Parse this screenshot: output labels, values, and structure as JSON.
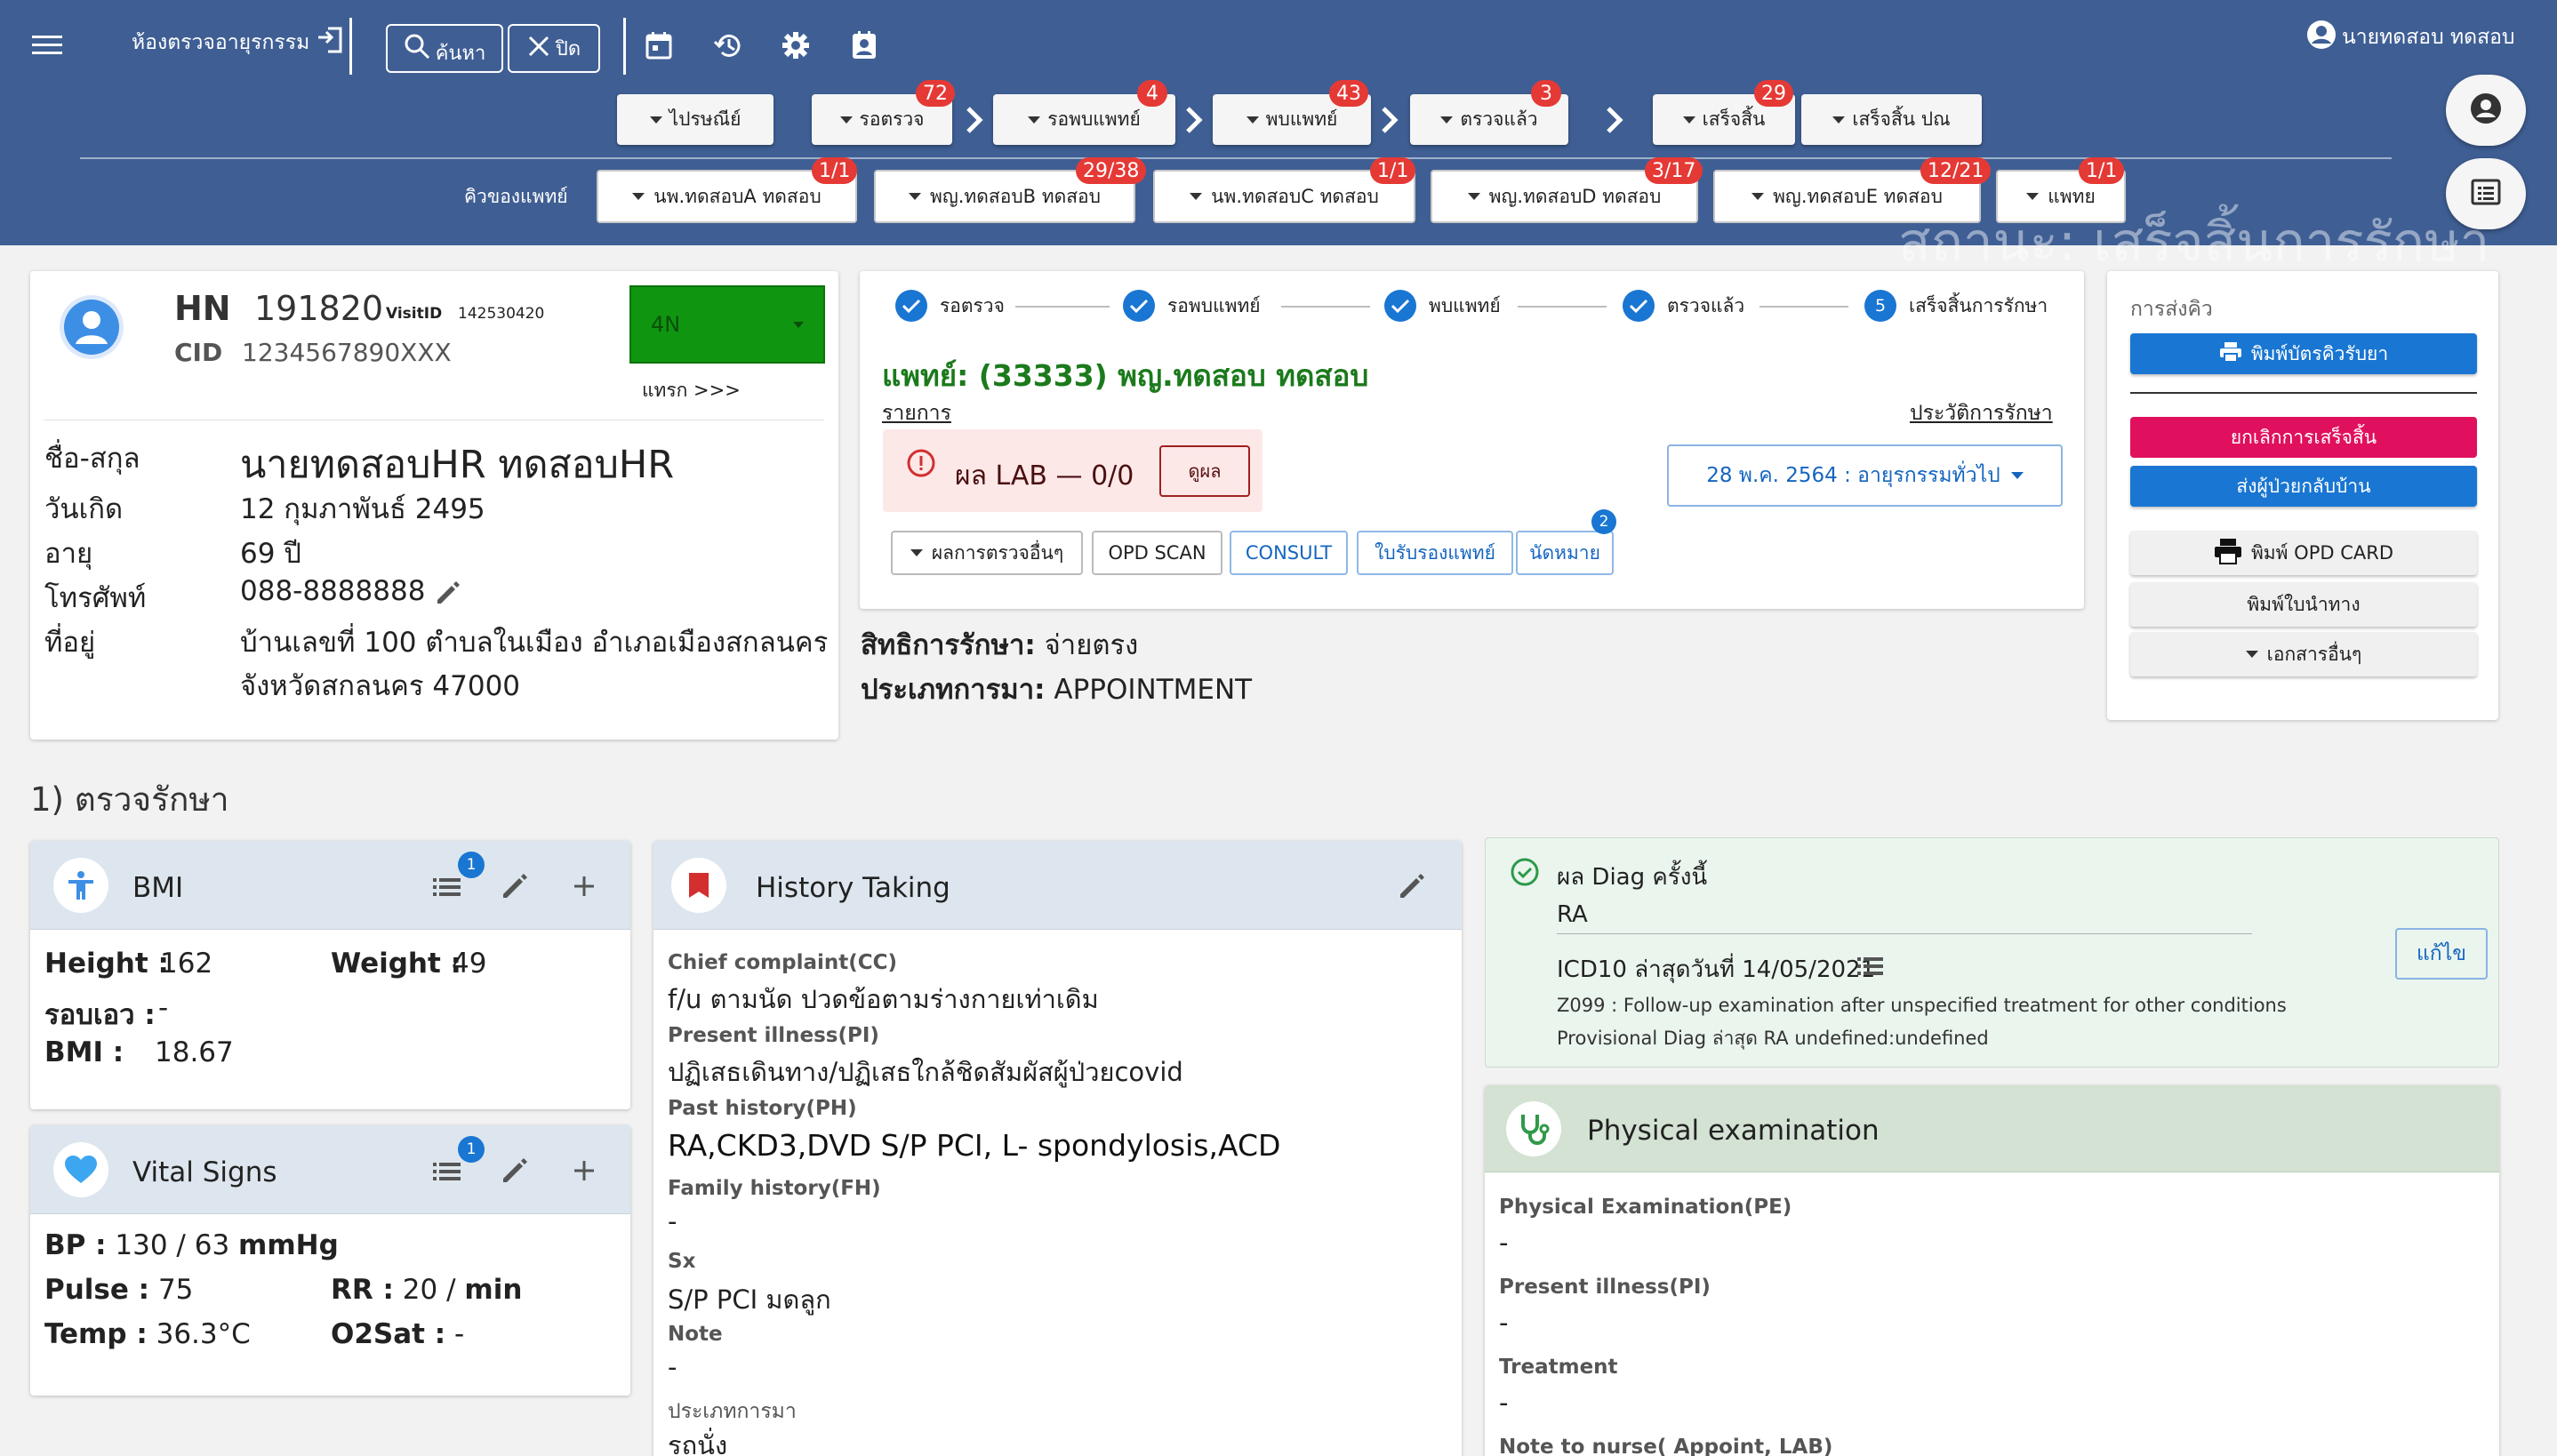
{
  "header": {
    "room_label": "ห้องตรวจอายุรกรรม",
    "search_label": "ค้นหา",
    "close_label": "ปิด",
    "user_name": "นายทดสอบ ทดสอบ",
    "ghost_status": "สถานะ: เสร็จสิ้นการรักษา"
  },
  "status_buttons": [
    {
      "label": "ไปรษณีย์",
      "badge": ""
    },
    {
      "label": "รอตรวจ",
      "badge": "72"
    },
    {
      "label": "รอพบแพทย์",
      "badge": "4"
    },
    {
      "label": "พบแพทย์",
      "badge": "43"
    },
    {
      "label": "ตรวจแล้ว",
      "badge": "3"
    },
    {
      "label": "เสร็จสิ้น",
      "badge": "29"
    },
    {
      "label": "เสร็จสิ้น ปณ",
      "badge": ""
    }
  ],
  "doctor_queue": {
    "label": "คิวของแพทย์",
    "doctors": [
      {
        "label": "นพ.ทดสอบA ทดสอบ",
        "badge": "1/1"
      },
      {
        "label": "พญ.ทดสอบB ทดสอบ",
        "badge": "29/38"
      },
      {
        "label": "นพ.ทดสอบC ทดสอบ",
        "badge": "1/1"
      },
      {
        "label": "พญ.ทดสอบD ทดสอบ",
        "badge": "3/17"
      },
      {
        "label": "พญ.ทดสอบE ทดสอบ",
        "badge": "12/21"
      },
      {
        "label": "แพทย",
        "badge": "1/1"
      }
    ]
  },
  "patient": {
    "hn_label": "HN",
    "hn": "191820",
    "visit_label": "VisitID",
    "visit_id": "142530420",
    "cid_label": "CID",
    "cid": "1234567890XXX",
    "zone": "4N",
    "insert_link": "แทรก >>>",
    "name_label": "ชื่อ-สกุล",
    "name": "นายทดสอบHR ทดสอบHR",
    "dob_label": "วันเกิด",
    "dob": "12 กุมภาพันธ์ 2495",
    "age_label": "อายุ",
    "age": "69 ปี",
    "phone_label": "โทรศัพท์",
    "phone": "088-8888888",
    "address_label": "ที่อยู่",
    "address_line1": "บ้านเลขที่ 100 ตำบลในเมือง อำเภอเมืองสกลนคร",
    "address_line2": "จังหวัดสกลนคร 47000"
  },
  "workflow": {
    "steps": [
      {
        "label": "รอตรวจ"
      },
      {
        "label": "รอพบแพทย์"
      },
      {
        "label": "พบแพทย์"
      },
      {
        "label": "ตรวจแล้ว"
      },
      {
        "label": "เสร็จสิ้นการรักษา",
        "number": "5"
      }
    ],
    "doctor": "แพทย์: (33333) พญ.ทดสอบ ทดสอบ",
    "items_link": "รายการ",
    "history_link": "ประวัติการรักษา",
    "lab_text": "ผล LAB — 0/0",
    "lab_button": "ดูผล",
    "visit_select": "28 พ.ค. 2564 : อายุรกรรมทั่วไป",
    "actions": {
      "other_results": "ผลการตรวจอื่นๆ",
      "opd_scan": "OPD SCAN",
      "consult": "CONSULT",
      "medical_cert": "ใบรับรองแพทย์",
      "appointment": "นัดหมาย",
      "appointment_badge": "2"
    }
  },
  "coverage": {
    "right_label": "สิทธิการรักษา:",
    "right_value": "จ่ายตรง",
    "type_label": "ประเภทการมา:",
    "type_value": "APPOINTMENT"
  },
  "side_panel": {
    "title": "การส่งคิว",
    "print_queue": "พิมพ์บัตรคิวรับยา",
    "cancel_done": "ยกเลิกการเสร็จสิ้น",
    "send_home": "ส่งผู้ป่วยกลับบ้าน",
    "print_opd": "พิมพ์ OPD CARD",
    "print_guide": "พิมพ์ใบนำทาง",
    "other_docs": "เอกสารอื่นๆ"
  },
  "section_title": "1) ตรวจรักษา",
  "bmi": {
    "title": "BMI",
    "badge": "1",
    "height_label": "Height :",
    "height": "162",
    "weight_label": "Weight :",
    "weight": "49",
    "waist_label": "รอบเอว :",
    "waist": "-",
    "bmi_label": "BMI :",
    "bmi": "18.67"
  },
  "vitals": {
    "title": "Vital Signs",
    "badge": "1",
    "bp_label": "BP :",
    "bp": "130 / 63",
    "bp_unit": "mmHg",
    "pulse_label": "Pulse :",
    "pulse": "75",
    "rr_label": "RR :",
    "rr": "20 /",
    "rr_unit": "min",
    "temp_label": "Temp :",
    "temp": "36.3°C",
    "o2_label": "O2Sat :",
    "o2": "-"
  },
  "history": {
    "title": "History Taking",
    "cc_label": "Chief complaint(CC)",
    "cc": "f/u ตามนัด ปวดข้อตามร่างกายเท่าเดิม",
    "pi_label": "Present illness(PI)",
    "pi": "ปฏิเสธเดินทาง/ปฏิเสธใกล้ชิดสัมผัสผู้ป่วยcovid",
    "ph_label": "Past history(PH)",
    "ph": "RA,CKD3,DVD S/P PCI, L- spondylosis,ACD",
    "fh_label": "Family history(FH)",
    "fh": "-",
    "sx_label": "Sx",
    "sx": "S/P PCI มดลูก",
    "note_label": "Note",
    "note": "-",
    "arrival_label": "ประเภทการมา",
    "arrival": "รถนั่ง"
  },
  "diag": {
    "title": "ผล Diag ครั้งนี้",
    "value": "RA",
    "icd_label": "ICD10 ล่าสุดวันที่ 14/05/2021",
    "icd_detail": "Z099 : Follow-up examination after unspecified treatment for other conditions",
    "provisional": "Provisional Diag ล่าสุด RA undefined:undefined",
    "edit_button": "แก้ไข"
  },
  "physical": {
    "title": "Physical examination",
    "pe_label": "Physical Examination(PE)",
    "pe": "-",
    "pi_label": "Present illness(PI)",
    "pi": "-",
    "tx_label": "Treatment",
    "tx": "-",
    "note_label": "Note to nurse( Appoint, LAB)"
  },
  "colors": {
    "header": "#3f5f94",
    "accent_blue": "#1976d2",
    "doctor_green": "#1b7a1b",
    "zone_green": "#109510",
    "badge_red": "#e53935",
    "cancel_pink": "#e0105e"
  }
}
